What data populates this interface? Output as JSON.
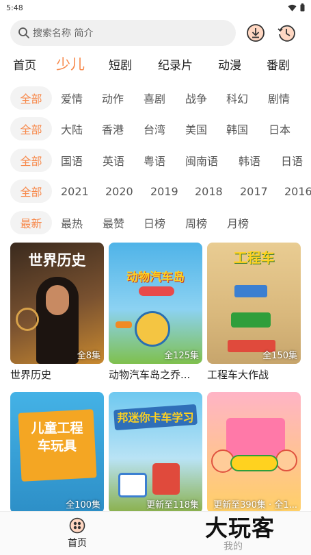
{
  "status": {
    "time": "5:48"
  },
  "search": {
    "placeholder": "搜索名称 简介"
  },
  "main_tabs": [
    "首页",
    "少儿",
    "短剧",
    "纪录片",
    "动漫",
    "番剧"
  ],
  "filters": {
    "genre": [
      "全部",
      "爱情",
      "动作",
      "喜剧",
      "战争",
      "科幻",
      "剧情"
    ],
    "region": [
      "全部",
      "大陆",
      "香港",
      "台湾",
      "美国",
      "韩国",
      "日本"
    ],
    "language": [
      "全部",
      "国语",
      "英语",
      "粤语",
      "闽南语",
      "韩语",
      "日语"
    ],
    "year": [
      "全部",
      "2021",
      "2020",
      "2019",
      "2018",
      "2017",
      "2016"
    ],
    "sort": [
      "最新",
      "最热",
      "最赞",
      "日榜",
      "周榜",
      "月榜"
    ]
  },
  "cards": [
    {
      "title": "世界历史",
      "poster_text": "世界历史",
      "badge": "全8集",
      "bg_top": "#3a2a1e",
      "bg_bottom": "#c8892f",
      "text_color": "#ffffff"
    },
    {
      "title": "动物汽车岛之乔...",
      "poster_text": "动物汽车岛",
      "badge": "全125集",
      "bg_top": "#4fb3e8",
      "bg_bottom": "#7fc04d",
      "text_color": "#ffd21f"
    },
    {
      "title": "工程车大作战",
      "poster_text": "工程车",
      "badge": "全150集",
      "bg_top": "#e9cc92",
      "bg_bottom": "#c7a56c",
      "text_color": "#ffd21f"
    },
    {
      "title": "",
      "poster_text": "儿童工程车玩具",
      "badge": "全100集",
      "bg_top": "#44b2e6",
      "bg_bottom": "#2d8fc7",
      "text_color": "#ffffff"
    },
    {
      "title": "",
      "poster_text": "邦迷你卡车学习",
      "badge": "更新至118集",
      "bg_top": "#6ec8f0",
      "bg_bottom": "#8ab04a",
      "text_color": "#ffd21f"
    },
    {
      "title": "",
      "poster_text": "",
      "badge": "更新至390集 · 全1...",
      "bg_top": "#ffb4c6",
      "bg_bottom": "#ffd066",
      "text_color": "#ffffff"
    }
  ],
  "bottom_nav": {
    "home": "首页",
    "mine": "我的"
  },
  "watermark": "大玩客",
  "colors": {
    "accent": "#f7884a",
    "chip_bg": "#f3f3f3",
    "search_bg": "#f0f0f0"
  },
  "icons": {
    "search": "search-icon",
    "download": "download-icon",
    "history": "history-icon",
    "home": "home-icon",
    "wifi": "wifi-icon",
    "battery": "battery-icon"
  }
}
